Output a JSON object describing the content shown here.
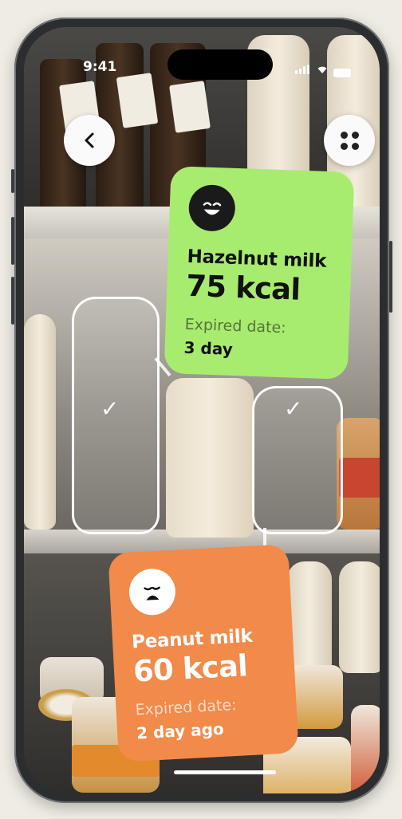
{
  "status_bar": {
    "time": "9:41"
  },
  "nav": {
    "back_icon": "chevron-left-icon",
    "menu_icon": "grid-dots-icon"
  },
  "products": [
    {
      "name": "Hazelnut milk",
      "kcal": "75 kcal",
      "expired_label": "Expired date:",
      "expired_value": "3 day",
      "icon": "happy-face-icon",
      "color": "#a8ec6f"
    },
    {
      "name": "Peanut milk",
      "kcal": "60 kcal",
      "expired_label": "Expired date:",
      "expired_value": "2 day ago",
      "icon": "sad-face-icon",
      "color": "#f28a4a"
    }
  ],
  "selection": {
    "checked_icon": "checkmark-icon",
    "check_glyph": "✓"
  }
}
